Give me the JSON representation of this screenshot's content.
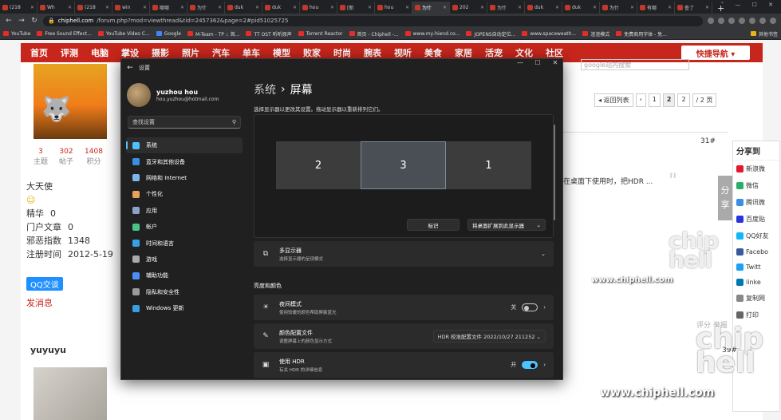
{
  "browser": {
    "tabs": [
      {
        "label": "(218"
      },
      {
        "label": "Wh"
      },
      {
        "label": "(218"
      },
      {
        "label": "win"
      },
      {
        "label": "哪哪"
      },
      {
        "label": "为什"
      },
      {
        "label": "duk"
      },
      {
        "label": "duk"
      },
      {
        "label": "hou"
      },
      {
        "label": "[新"
      },
      {
        "label": "hou"
      },
      {
        "label": "为什"
      },
      {
        "label": "202"
      },
      {
        "label": "为什"
      },
      {
        "label": "duk"
      },
      {
        "label": "duk"
      },
      {
        "label": "为什"
      },
      {
        "label": "有哪"
      },
      {
        "label": "查了"
      }
    ],
    "url_host": "chiphell.com",
    "url_path": "/forum.php?mod=viewthread&tid=2457362&page=2#pid51025725",
    "bookmarks": [
      "YouTube",
      "Free Sound Effect...",
      "YouTube Video C...",
      "Google",
      "M-Team - TP :: 首...",
      "TT OST 听听原声",
      "Torrent Reactor",
      "首页 - Chiphell -...",
      "www.my-hiend.co...",
      "JOPENS自动定位...",
      "www.spaceweath...",
      "渣渣模式",
      "免费商用字体 - 免..."
    ],
    "other_bookmarks": "其他书签"
  },
  "site": {
    "nav": [
      "首页",
      "评测",
      "电脑",
      "掌设",
      "摄影",
      "照片",
      "汽车",
      "单车",
      "模型",
      "败家",
      "时尚",
      "腕表",
      "视听",
      "美食",
      "家居",
      "活宠",
      "文化",
      "社区"
    ],
    "quick_nav": "快捷导航 ▾",
    "search_placeholder": "google站内搜索",
    "user1": {
      "stats": [
        {
          "n": "3",
          "l": "主题"
        },
        {
          "n": "302",
          "l": "帖子"
        },
        {
          "n": "1408",
          "l": "积分"
        }
      ],
      "rank": "大天使",
      "fields": [
        {
          "k": "精华",
          "v": "0"
        },
        {
          "k": "门户文章",
          "v": "0"
        },
        {
          "k": "邪恶指数",
          "v": "1348"
        },
        {
          "k": "注册时间",
          "v": "2012-5-19"
        }
      ],
      "qq": "QQ交谈",
      "msg": "发消息"
    },
    "user2": "yuyuyu",
    "pager": {
      "back": "◂ 返回列表",
      "p1": "1",
      "p2": "2",
      "input": "2",
      "total": "/ 2 页"
    },
    "floor": "31#",
    "post_text": "在桌面下使用时，把HDR ...",
    "share_title": "分享到",
    "share_tab": "分享",
    "share_items": [
      "新浪微",
      "微信",
      "腾讯微",
      "百度贴",
      "QQ好友",
      "Facebo",
      "Twitt",
      "linke",
      "复制网",
      "打印"
    ],
    "rate": "评分  举报",
    "floor2": "39#",
    "watermark_small": "www.chiphell.com",
    "watermark_big": "www.chiphell.com",
    "logo_a": "chip hell",
    "logo_b": "chip hell"
  },
  "settings": {
    "window_title": "设置",
    "user_name": "yuzhou hou",
    "user_email": "hou.yuzhou@hotmail.com",
    "search_placeholder": "查找设置",
    "nav": [
      {
        "label": "系统",
        "color": "#4cc2ff"
      },
      {
        "label": "蓝牙和其他设备",
        "color": "#3a8ee6"
      },
      {
        "label": "网络和 Internet",
        "color": "#7ab6f0"
      },
      {
        "label": "个性化",
        "color": "#e8a25c"
      },
      {
        "label": "应用",
        "color": "#8aa2c8"
      },
      {
        "label": "帐户",
        "color": "#4cc28a"
      },
      {
        "label": "时间和语言",
        "color": "#3aa0e6"
      },
      {
        "label": "游戏",
        "color": "#aaaaaa"
      },
      {
        "label": "辅助功能",
        "color": "#4c8ef5"
      },
      {
        "label": "隐私和安全性",
        "color": "#9a9a9a"
      },
      {
        "label": "Windows 更新",
        "color": "#3a9ee6"
      }
    ],
    "breadcrumb_parent": "系统",
    "breadcrumb_sep": "›",
    "breadcrumb_current": "屏幕",
    "hint": "选择显示器以更改其设置。拖动显示器以重新排列它们。",
    "monitors": [
      "2",
      "3",
      "1"
    ],
    "identify": "标识",
    "extend": "将桌面扩展到此显示器",
    "multi_title": "多显示器",
    "multi_sub": "选择显示器的呈现模式",
    "section": "亮度和颜色",
    "night_title": "夜间模式",
    "night_sub": "使用较暖的颜色帮助屏蔽蓝光",
    "night_state": "关",
    "profile_title": "颜色配置文件",
    "profile_sub": "调整屏幕上的颜色显示方式",
    "profile_value": "HDR 校准配置文件 2022/10/27 211252",
    "hdr_title": "使用 HDR",
    "hdr_sub": "有关 HDR 的详细信息",
    "hdr_state": "开"
  }
}
